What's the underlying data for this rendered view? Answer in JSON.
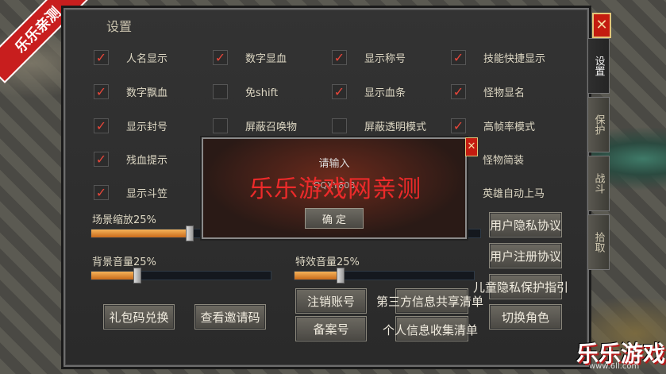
{
  "corner_tag": "乐乐亲测",
  "window": {
    "title": "设置",
    "close_glyph": "✕"
  },
  "side_tabs": [
    "设置",
    "保护",
    "战斗",
    "拾取"
  ],
  "options": {
    "name_show": {
      "label": "人名显示",
      "checked": true
    },
    "number_hp": {
      "label": "数字显血",
      "checked": true
    },
    "show_title": {
      "label": "显示称号",
      "checked": true
    },
    "skill_shortcut": {
      "label": "技能快捷显示",
      "checked": true
    },
    "number_float": {
      "label": "数字飘血",
      "checked": true
    },
    "no_shift": {
      "label": "免shift",
      "checked": false
    },
    "show_hpbar": {
      "label": "显示血条",
      "checked": true
    },
    "monster_name": {
      "label": "怪物显名",
      "checked": true
    },
    "show_seal": {
      "label": "显示封号",
      "checked": true
    },
    "hide_summon": {
      "label": "屏蔽召唤物",
      "checked": false
    },
    "hide_transparent": {
      "label": "屏蔽透明模式",
      "checked": false
    },
    "high_fps": {
      "label": "高帧率模式",
      "checked": true
    },
    "low_hp_hint": {
      "label": "残血提示",
      "checked": true
    },
    "monster_simple": {
      "label": "怪物简装",
      "checked": false
    },
    "show_hat": {
      "label": "显示斗笠",
      "checked": true
    },
    "hero_auto_mount": {
      "label": "英雄自动上马",
      "checked": false
    }
  },
  "sliders": {
    "scene_zoom": {
      "label": "场景缩放25%",
      "percent": 25
    },
    "bg_volume": {
      "label": "背景音量25%",
      "percent": 25
    },
    "fx_volume": {
      "label": "特效音量25%",
      "percent": 25
    }
  },
  "buttons": {
    "gift_code": "礼包码兑换",
    "invite_code": "查看邀请码",
    "cancel_account": "注销账号",
    "third_party": "第三方信息共享清单",
    "record_no": "备案号",
    "personal_info": "个人信息收集清单",
    "privacy": "用户隐私协议",
    "register": "用户注册协议",
    "child_privacy": "儿童隐私保护指引",
    "switch_role": "切换角色"
  },
  "dialog": {
    "prompt": "请输入",
    "value": "QQXY808",
    "ok": "确 定",
    "close_glyph": "✕"
  },
  "watermark": "乐乐游戏网亲测",
  "logo": {
    "text": "乐乐游戏",
    "url": "www.6ll.com"
  },
  "colors": {
    "check": "#e8463a",
    "accent_fill": "#f0a040",
    "close_red": "#c41c10"
  }
}
